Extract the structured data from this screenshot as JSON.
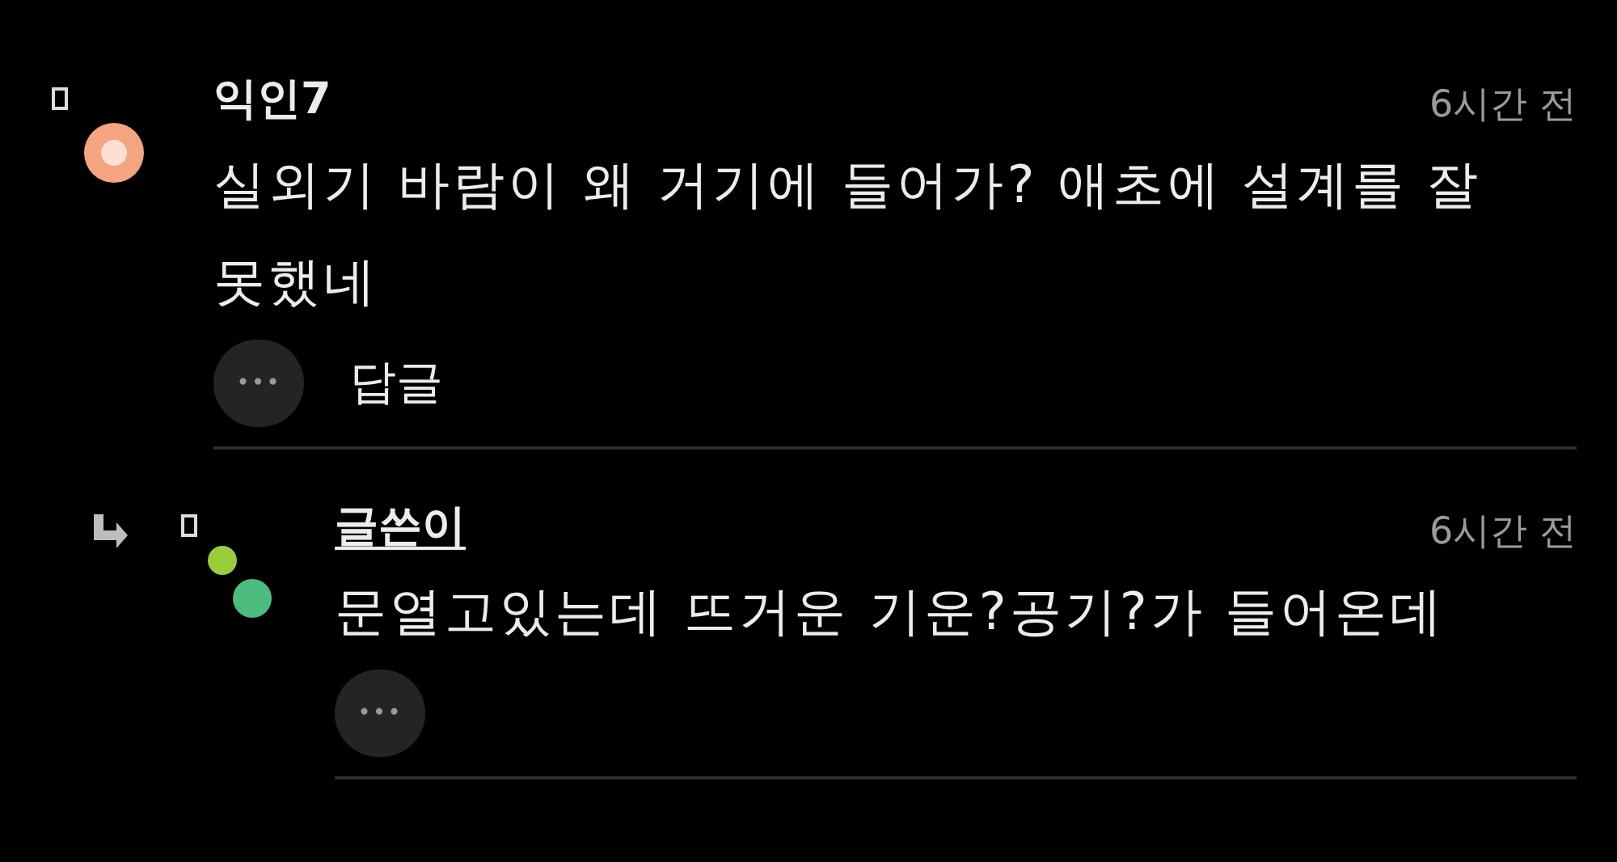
{
  "comments": [
    {
      "kind": "comment",
      "author": "익인7",
      "is_author": false,
      "time": "6시간 전",
      "text": "실외기 바람이 왜 거기에 들어가? 애초에 설계를 잘 못했네",
      "more": "•••",
      "reply_label": "답글"
    },
    {
      "kind": "reply",
      "author": "글쓴이",
      "is_author": true,
      "time": "6시간 전",
      "text": "문열고있는데 뜨거운 기운?공기?가 들어온데",
      "more": "•••"
    }
  ]
}
